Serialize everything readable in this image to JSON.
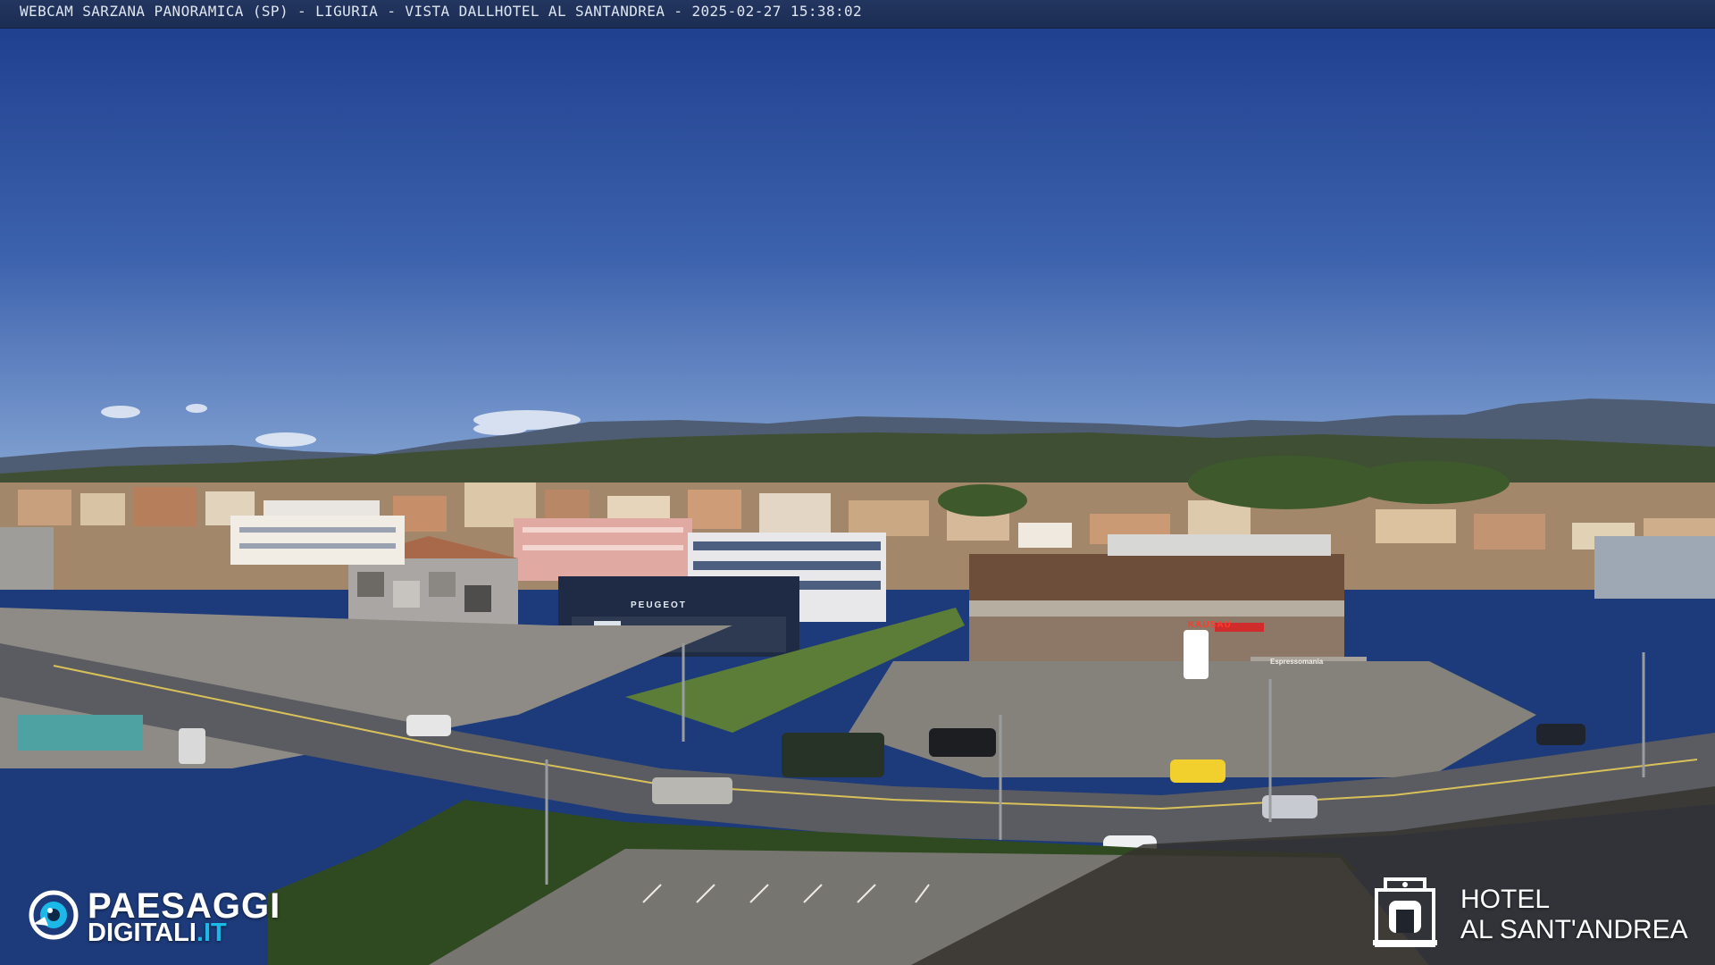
{
  "caption": {
    "text": "WEBCAM SARZANA PANORAMICA (SP) - LIGURIA - VISTA DALLHOTEL AL SANTANDREA - 2025-02-27  15:38:02"
  },
  "scene_signs": {
    "peugeot": "PEUGEOT",
    "kausau": "KAUSAU",
    "espressomania": "Espressomania"
  },
  "brand_left": {
    "line1": "PAESAGGI",
    "line2_main": "DIGITALI",
    "line2_suffix": ".IT",
    "icon": "eye-icon"
  },
  "brand_right": {
    "line1": "HOTEL",
    "line2": "AL SANT'ANDREA",
    "icon": "hotel-building-icon"
  },
  "colors": {
    "sky_top": "#1c3c8c",
    "sky_bottom": "#6f93c8",
    "accent": "#1bb8e8"
  }
}
